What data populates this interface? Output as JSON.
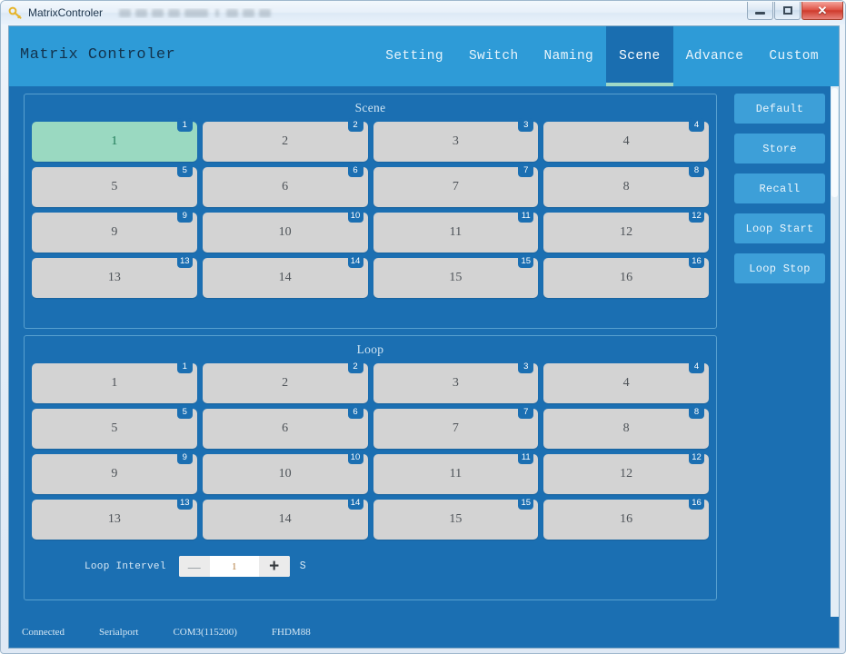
{
  "window": {
    "titlebar_text": "MatrixControler",
    "icon": "key-icon",
    "controls": {
      "minimize": "Minimize",
      "maximize": "Maximize",
      "close": "✕"
    }
  },
  "header": {
    "app_title": "Matrix Controler",
    "tabs": [
      {
        "label": "Setting",
        "active": false
      },
      {
        "label": "Switch",
        "active": false
      },
      {
        "label": "Naming",
        "active": false
      },
      {
        "label": "Scene",
        "active": true
      },
      {
        "label": "Advance",
        "active": false
      },
      {
        "label": "Custom",
        "active": false
      }
    ]
  },
  "scene_panel": {
    "title": "Scene",
    "selected_index": 1,
    "cells": [
      {
        "label": "1",
        "badge": "1"
      },
      {
        "label": "2",
        "badge": "2"
      },
      {
        "label": "3",
        "badge": "3"
      },
      {
        "label": "4",
        "badge": "4"
      },
      {
        "label": "5",
        "badge": "5"
      },
      {
        "label": "6",
        "badge": "6"
      },
      {
        "label": "7",
        "badge": "7"
      },
      {
        "label": "8",
        "badge": "8"
      },
      {
        "label": "9",
        "badge": "9"
      },
      {
        "label": "10",
        "badge": "10"
      },
      {
        "label": "11",
        "badge": "11"
      },
      {
        "label": "12",
        "badge": "12"
      },
      {
        "label": "13",
        "badge": "13"
      },
      {
        "label": "14",
        "badge": "14"
      },
      {
        "label": "15",
        "badge": "15"
      },
      {
        "label": "16",
        "badge": "16"
      }
    ]
  },
  "loop_panel": {
    "title": "Loop",
    "selected_index": null,
    "cells": [
      {
        "label": "1",
        "badge": "1"
      },
      {
        "label": "2",
        "badge": "2"
      },
      {
        "label": "3",
        "badge": "3"
      },
      {
        "label": "4",
        "badge": "4"
      },
      {
        "label": "5",
        "badge": "5"
      },
      {
        "label": "6",
        "badge": "6"
      },
      {
        "label": "7",
        "badge": "7"
      },
      {
        "label": "8",
        "badge": "8"
      },
      {
        "label": "9",
        "badge": "9"
      },
      {
        "label": "10",
        "badge": "10"
      },
      {
        "label": "11",
        "badge": "11"
      },
      {
        "label": "12",
        "badge": "12"
      },
      {
        "label": "13",
        "badge": "13"
      },
      {
        "label": "14",
        "badge": "14"
      },
      {
        "label": "15",
        "badge": "15"
      },
      {
        "label": "16",
        "badge": "16"
      }
    ],
    "interval": {
      "label": "Loop Intervel",
      "decrement": "—",
      "value": "1",
      "increment": "+",
      "unit": "S"
    }
  },
  "side_actions": [
    {
      "label": "Default"
    },
    {
      "label": "Store"
    },
    {
      "label": "Recall"
    },
    {
      "label": "Loop Start"
    },
    {
      "label": "Loop Stop"
    }
  ],
  "status_bar": {
    "connection": "Connected",
    "interface": "Serialport",
    "port": "COM3(115200)",
    "device": "FHDM88"
  },
  "colors": {
    "header_blue": "#2e9bd7",
    "content_blue": "#1b6fb2",
    "active_tab_blue": "#1a6eb0",
    "active_tab_underline": "#9fd9c7",
    "cell_gray": "#d3d3d3",
    "cell_selected_green": "#9ad9c1",
    "side_button_blue": "#3d9fd8"
  }
}
